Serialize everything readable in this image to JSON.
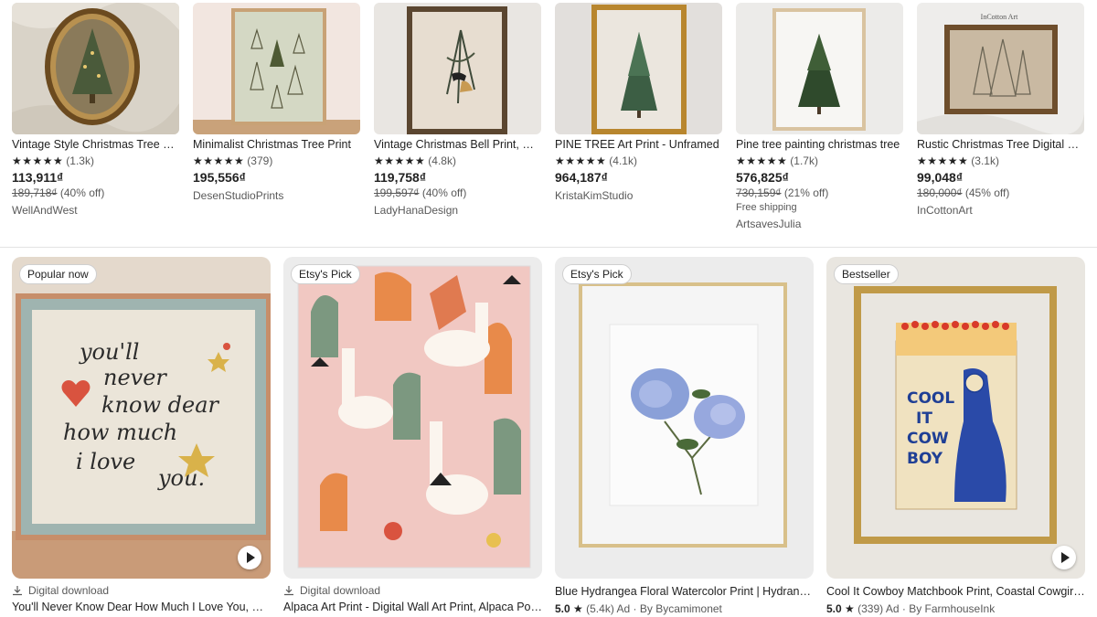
{
  "top_listings": [
    {
      "title": "Vintage Style Christmas Tree Print",
      "stars": "★★★★★",
      "reviews": "(1.3k)",
      "price": "113,911₫",
      "original_price": "189,718₫",
      "discount": "(40% off)",
      "shipping": "",
      "shop": "WellAndWest"
    },
    {
      "title": "Minimalist Christmas Tree Print",
      "stars": "★★★★★",
      "reviews": "(379)",
      "price": "195,556₫",
      "original_price": "",
      "discount": "",
      "shipping": "",
      "shop": "DesenStudioPrints"
    },
    {
      "title": "Vintage Christmas Bell Print, Holiday",
      "stars": "★★★★★",
      "reviews": "(4.8k)",
      "price": "119,758₫",
      "original_price": "199,597₫",
      "discount": "(40% off)",
      "shipping": "",
      "shop": "LadyHanaDesign"
    },
    {
      "title": "PINE TREE Art Print - Unframed",
      "stars": "★★★★★",
      "reviews": "(4.1k)",
      "price": "964,187₫",
      "original_price": "",
      "discount": "",
      "shipping": "",
      "shop": "KristaKimStudio"
    },
    {
      "title": "Pine tree painting christmas tree",
      "stars": "★★★★★",
      "reviews": "(1.7k)",
      "price": "576,825₫",
      "original_price": "730,159₫",
      "discount": "(21% off)",
      "shipping": "Free shipping",
      "shop": "ArtsavesJulia"
    },
    {
      "title": "Rustic Christmas Tree Digital Print",
      "stars": "★★★★★",
      "reviews": "(3.1k)",
      "price": "99,048₫",
      "original_price": "180,000₫",
      "discount": "(45% off)",
      "shipping": "",
      "shop": "InCottonArt"
    }
  ],
  "bottom_listings": [
    {
      "badge": "Popular now",
      "download_label": "Digital download",
      "title": "You'll Never Know Dear How Much I Love You, Print",
      "rating": "",
      "star": "",
      "reviews": "",
      "ad": "",
      "by_shop": "",
      "has_video": true
    },
    {
      "badge": "Etsy's Pick",
      "download_label": "Digital download",
      "title": "Alpaca Art Print - Digital Wall Art Print, Alpaca Poster",
      "rating": "",
      "star": "",
      "reviews": "",
      "ad": "",
      "by_shop": "",
      "has_video": false
    },
    {
      "badge": "Etsy's Pick",
      "download_label": "",
      "title": "Blue Hydrangea Floral Watercolor Print | Hydrangea Art",
      "rating": "5.0",
      "star": "★",
      "reviews": "(5.4k)",
      "ad": "Ad",
      "by_shop": "By Bycamimonet",
      "has_video": false
    },
    {
      "badge": "Bestseller",
      "download_label": "",
      "title": "Cool It Cowboy Matchbook Print, Coastal Cowgirl Decor",
      "rating": "5.0",
      "star": "★",
      "reviews": "(339)",
      "ad": "Ad",
      "by_shop": "By FarmhouseInk",
      "has_video": true
    }
  ],
  "artwork_text": {
    "love_print": [
      "you'll",
      "never",
      "know dear",
      "how much",
      "i love",
      "you."
    ],
    "matchbook": [
      "COOL",
      "IT",
      "COW",
      "BOY"
    ],
    "frame_mark": "InCotton Art"
  },
  "icons": {
    "download": "download-icon",
    "play": "play-icon",
    "star": "star-icon"
  },
  "colors": {
    "text": "#222222",
    "muted": "#595959",
    "divider": "#e3e3e3",
    "badge_border": "#cfcfcf"
  }
}
